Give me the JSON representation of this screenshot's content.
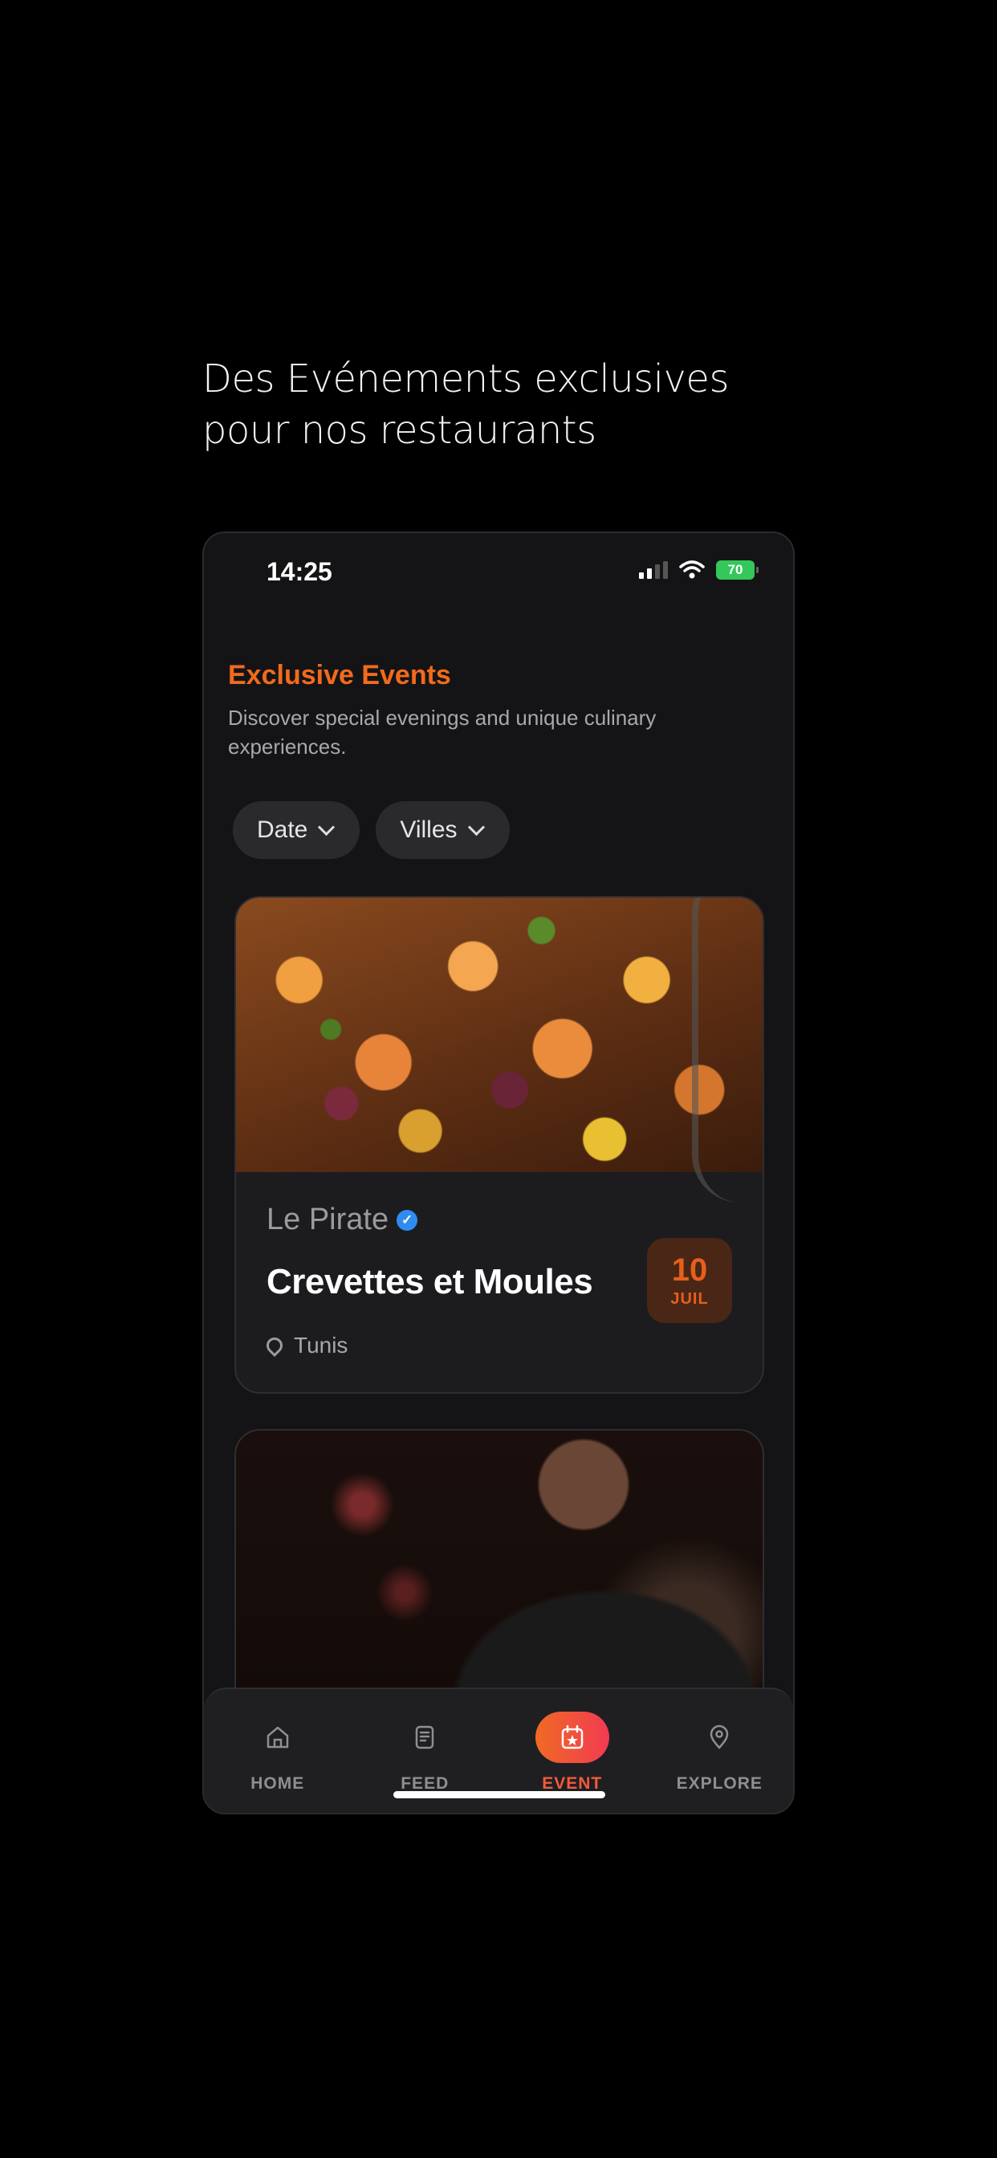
{
  "headline": {
    "line1": "Des Evénements exclusives",
    "line2": "pour nos restaurants"
  },
  "status_bar": {
    "time": "14:25",
    "battery": "70"
  },
  "page": {
    "title": "Exclusive Events",
    "subtitle": "Discover special evenings and unique culinary experiences."
  },
  "filters": [
    {
      "label": "Date",
      "icon": "chevron-down-icon"
    },
    {
      "label": "Villes",
      "icon": "chevron-down-icon"
    }
  ],
  "events": [
    {
      "venue": "Le Pirate",
      "verified": true,
      "title": "Crevettes et Moules",
      "location": "Tunis",
      "date_day": "10",
      "date_month": "JUIL",
      "image": "shrimp-dish-photo"
    },
    {
      "image": "chef-photo"
    }
  ],
  "tabbar": {
    "items": [
      {
        "label": "HOME",
        "icon": "home-icon",
        "active": false
      },
      {
        "label": "FEED",
        "icon": "feed-icon",
        "active": false
      },
      {
        "label": "EVENT",
        "icon": "event-icon",
        "active": true
      },
      {
        "label": "EXPLORE",
        "icon": "map-pin-icon",
        "active": false
      }
    ]
  },
  "colors": {
    "accent": "#f26a1b",
    "background": "#000000",
    "phone_bg": "#141416",
    "card_bg": "#1c1c1f",
    "verified": "#2f8cf0"
  }
}
